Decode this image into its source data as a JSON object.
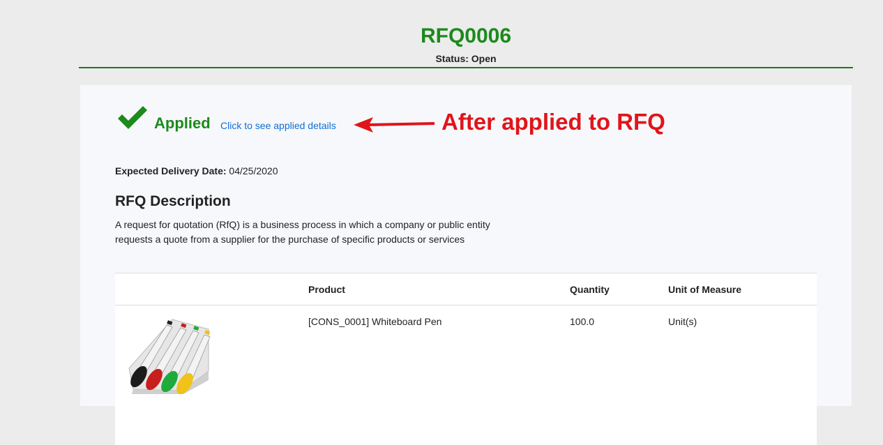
{
  "header": {
    "title": "RFQ0006",
    "status_label": "Status:",
    "status_value": "Open"
  },
  "applied": {
    "label": "Applied",
    "link_text": "Click to see applied details",
    "annotation": "After applied to RFQ"
  },
  "delivery": {
    "label": "Expected Delivery Date:",
    "value": "04/25/2020"
  },
  "description": {
    "title": "RFQ Description",
    "text": "A request for quotation (RfQ) is a business process in which a company or public entity requests a quote from a supplier for the purchase of specific products or services"
  },
  "table": {
    "columns": [
      "",
      "Product",
      "Quantity",
      "Unit of Measure"
    ],
    "rows": [
      {
        "product": "[CONS_0001] Whiteboard Pen",
        "quantity": "100.0",
        "uom": "Unit(s)"
      }
    ]
  },
  "colors": {
    "accent_green": "#1c8a1c",
    "link_blue": "#0f6fd1",
    "annotation_red": "#e0151a"
  },
  "icons": {
    "check": "check-icon",
    "arrow": "arrow-left-icon",
    "product": "whiteboard-pens-image"
  }
}
